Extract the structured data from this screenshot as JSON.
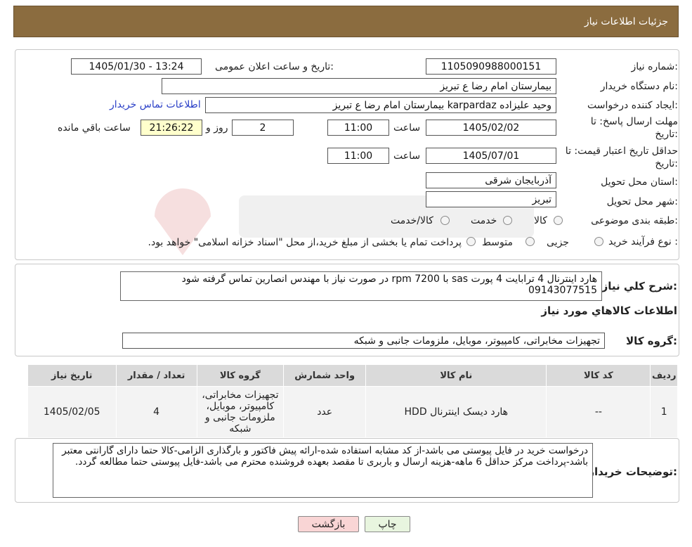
{
  "header": {
    "title": "جزئیات اطلاعات نیاز"
  },
  "form": {
    "need_number_label": "شماره نیاز:",
    "need_number_value": "1105090988000151",
    "announce_label": "تاریخ و ساعت اعلان عمومی:",
    "announce_value": "1405/01/30 - 13:24",
    "buyer_org_label": "نام دستگاه خریدار:",
    "buyer_org_value": "بیمارستان امام رضا  ع  تبریز",
    "creator_label": "ایجاد کننده درخواست:",
    "creator_value": "وحید علیزاده karpardaz بیمارستان امام رضا  ع  تبریز",
    "contact_link": "اطلاعات تماس خریدار",
    "deadline_label_1": "مهلت ارسال پاسخ: تا",
    "deadline_label_2": "تاریخ:",
    "deadline_date": "1405/02/02",
    "time_label": "ساعت",
    "deadline_time": "11:00",
    "days_value": "2",
    "days_label": "روز و",
    "remaining_value": "21:26:22",
    "remaining_label": "ساعت باقي مانده",
    "validity_label_1": "حداقل تاریخ اعتبار قیمت: تا",
    "validity_label_2": "تاریخ:",
    "validity_date": "1405/07/01",
    "validity_time": "11:00",
    "province_label": "استان محل تحویل:",
    "province_value": "آذربایجان شرقی",
    "city_label": "شهر محل تحویل:",
    "city_value": "تبریز",
    "category_label": "طبقه بندی موضوعی:",
    "category_options": [
      "کالا",
      "خدمت",
      "کالا/خدمت"
    ],
    "process_label": "نوع فرآیند خرید :",
    "process_options": [
      "جزیی",
      "متوسط"
    ],
    "process_note": "پرداخت تمام یا بخشی از مبلغ خرید،از محل \"اسناد خزانه اسلامی\" خواهد بود."
  },
  "description": {
    "label": "شرح كلي نياز:",
    "text": "هارد اینترنال 4 ترابایت 4 پورت sas با rpm 7200 در صورت نیاز با مهندس انصارین تماس گرفته شود 09143077515"
  },
  "goods": {
    "section_title": "اطلاعات كالاهاي مورد نياز",
    "group_label": "گروه کالا:",
    "group_value": "تجهیزات مخابراتی، کامپیوتر، موبایل، ملزومات جانبی و شبکه",
    "columns": [
      "ردیف",
      "کد کالا",
      "نام کالا",
      "واحد شمارش",
      "گروه کالا",
      "تعداد / مقدار",
      "تاریخ نیاز"
    ],
    "rows": [
      [
        "1",
        "--",
        "هارد دیسک اینترنال HDD",
        "عدد",
        "تجهیزات مخابراتی، کامپیوتر، موبایل، ملزومات جانبی و شبکه",
        "4",
        "1405/02/05"
      ]
    ]
  },
  "buyer_notes": {
    "label": "توضیحات خریدار:",
    "text": "درخواست خرید در فایل پیوستی می باشد-از کد مشابه استفاده شده-ارائه پیش فاکتور و بارگذاری الزامی-کالا حتما دارای گارانتی معتبر باشد-پرداخت مرکز حداقل 6 ماهه-هزینه ارسال و باربری تا مقصد بعهده فروشنده محترم می باشد-فایل پیوستی حتما مطالعه گردد."
  },
  "buttons": {
    "print": "چاپ",
    "back": "بازگشت"
  },
  "colors": {
    "header_bg": "#8b6c3f",
    "link": "#2a3fc7",
    "yellow_box": "#ffffcc",
    "back_btn": "#f9d5d5",
    "print_btn": "#e8f5df"
  }
}
